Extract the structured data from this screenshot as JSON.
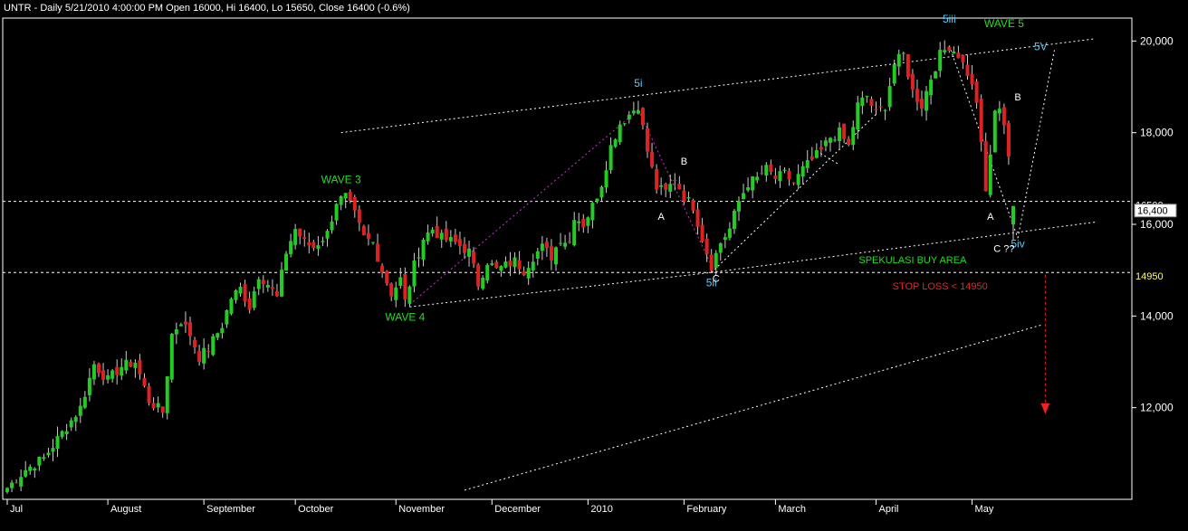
{
  "header": {
    "title": "UNTR - Daily 5/21/2010 4:00:00 PM Open 16000, Hi 16400, Lo 15650, Close 16400 (-0.6%)"
  },
  "colors": {
    "background": "#000000",
    "up": "#22cc22",
    "down": "#dd2222",
    "grid": "#ffffff",
    "wave_label": "#22dd22",
    "sub_label": "#55ccff",
    "stop": "#ee2222",
    "buy": "#22dd22",
    "level": "#ffff66",
    "abc": "#ffffff",
    "wave_line": "#cc33cc"
  },
  "chart_data": {
    "type": "candlestick",
    "title": "UNTR - Daily 5/21/2010 4:00:00 PM Open 16000, Hi 16400, Lo 15650, Close 16400 (-0.6%)",
    "ylim": [
      10000,
      20500
    ],
    "yticks": [
      12000,
      14000,
      16000,
      18000,
      20000
    ],
    "ytick_labels": [
      "12,000",
      "14,000",
      "16,000",
      "18,000",
      "20,000"
    ],
    "x_months": [
      {
        "label": "Jul",
        "index": 0
      },
      {
        "label": "August",
        "index": 22
      },
      {
        "label": "September",
        "index": 43
      },
      {
        "label": "October",
        "index": 63
      },
      {
        "label": "November",
        "index": 85
      },
      {
        "label": "December",
        "index": 106
      },
      {
        "label": "2010",
        "index": 127
      },
      {
        "label": "February",
        "index": 148
      },
      {
        "label": "March",
        "index": 168
      },
      {
        "label": "April",
        "index": 190
      },
      {
        "label": "May",
        "index": 211
      }
    ],
    "n_bars": 221,
    "anchors": [
      [
        0,
        10250
      ],
      [
        4,
        10650
      ],
      [
        8,
        10900
      ],
      [
        12,
        11450
      ],
      [
        16,
        12000
      ],
      [
        19,
        12950
      ],
      [
        22,
        12600
      ],
      [
        25,
        12900
      ],
      [
        28,
        13000
      ],
      [
        31,
        12150
      ],
      [
        34,
        11900
      ],
      [
        36,
        13600
      ],
      [
        38,
        13900
      ],
      [
        40,
        13600
      ],
      [
        42,
        13100
      ],
      [
        44,
        13300
      ],
      [
        47,
        13800
      ],
      [
        49,
        14400
      ],
      [
        51,
        14600
      ],
      [
        53,
        14200
      ],
      [
        55,
        14900
      ],
      [
        57,
        14700
      ],
      [
        59,
        14400
      ],
      [
        61,
        15400
      ],
      [
        63,
        15900
      ],
      [
        65,
        15600
      ],
      [
        67,
        15500
      ],
      [
        70,
        15800
      ],
      [
        72,
        16500
      ],
      [
        74,
        16600
      ],
      [
        76,
        16200
      ],
      [
        78,
        15700
      ],
      [
        80,
        15600
      ],
      [
        82,
        15000
      ],
      [
        84,
        14500
      ],
      [
        86,
        14800
      ],
      [
        87,
        14300
      ],
      [
        89,
        15100
      ],
      [
        91,
        15700
      ],
      [
        93,
        15900
      ],
      [
        95,
        15700
      ],
      [
        98,
        15600
      ],
      [
        101,
        15400
      ],
      [
        103,
        14700
      ],
      [
        105,
        15200
      ],
      [
        107,
        15000
      ],
      [
        109,
        15100
      ],
      [
        111,
        15200
      ],
      [
        113,
        15000
      ],
      [
        115,
        15300
      ],
      [
        117,
        15500
      ],
      [
        119,
        15300
      ],
      [
        121,
        15700
      ],
      [
        123,
        15600
      ],
      [
        124,
        16200
      ],
      [
        126,
        16000
      ],
      [
        128,
        16400
      ],
      [
        130,
        16900
      ],
      [
        132,
        17700
      ],
      [
        134,
        18200
      ],
      [
        136,
        18400
      ],
      [
        138,
        18600
      ],
      [
        140,
        17600
      ],
      [
        142,
        16800
      ],
      [
        144,
        16700
      ],
      [
        146,
        17000
      ],
      [
        148,
        16600
      ],
      [
        150,
        16400
      ],
      [
        152,
        15700
      ],
      [
        154,
        15100
      ],
      [
        156,
        15600
      ],
      [
        158,
        15900
      ],
      [
        160,
        16500
      ],
      [
        162,
        16900
      ],
      [
        164,
        17000
      ],
      [
        166,
        17200
      ],
      [
        168,
        17000
      ],
      [
        170,
        17100
      ],
      [
        172,
        16900
      ],
      [
        174,
        17200
      ],
      [
        176,
        17400
      ],
      [
        178,
        17600
      ],
      [
        180,
        17900
      ],
      [
        182,
        18000
      ],
      [
        184,
        17700
      ],
      [
        186,
        18600
      ],
      [
        188,
        18800
      ],
      [
        190,
        18400
      ],
      [
        192,
        18600
      ],
      [
        194,
        19500
      ],
      [
        196,
        19700
      ],
      [
        198,
        18900
      ],
      [
        200,
        18600
      ],
      [
        202,
        19200
      ],
      [
        204,
        19700
      ],
      [
        206,
        19900
      ],
      [
        208,
        19700
      ],
      [
        210,
        19300
      ],
      [
        212,
        18700
      ],
      [
        214,
        16700
      ],
      [
        216,
        18400
      ],
      [
        217,
        18600
      ],
      [
        218,
        18200
      ],
      [
        219,
        17500
      ],
      [
        220,
        16400
      ]
    ],
    "last_bar": {
      "open": 16000,
      "high": 16400,
      "low": 15650,
      "close": 16400
    },
    "levels": [
      {
        "value": 16500,
        "label": "16500"
      },
      {
        "value": 14950,
        "label": "14950"
      }
    ],
    "last_price": {
      "value": 16400,
      "label": "16,400"
    },
    "annotations": [
      {
        "text": "WAVE 3",
        "type": "wave",
        "index": 73,
        "value": 16900
      },
      {
        "text": "WAVE 4",
        "type": "wave",
        "index": 87,
        "value": 13900
      },
      {
        "text": "WAVE 5",
        "type": "wave",
        "index": 218,
        "value": 20300
      },
      {
        "text": "5i",
        "type": "sub",
        "index": 138,
        "value": 19000
      },
      {
        "text": "5ii",
        "type": "sub",
        "index": 154,
        "value": 14650
      },
      {
        "text": "5iii",
        "type": "sub",
        "index": 206,
        "value": 20400
      },
      {
        "text": "5iv",
        "type": "sub",
        "index": 221,
        "value": 15500
      },
      {
        "text": "5V",
        "type": "sub",
        "index": 226,
        "value": 19800
      },
      {
        "text": "A",
        "type": "abc",
        "index": 143,
        "value": 16100
      },
      {
        "text": "B",
        "type": "abc",
        "index": 148,
        "value": 17300
      },
      {
        "text": "C",
        "type": "abc",
        "index": 155,
        "value": 14750
      },
      {
        "text": "A",
        "type": "abc",
        "index": 215,
        "value": 16100
      },
      {
        "text": "B",
        "type": "abc",
        "index": 221,
        "value": 18700
      },
      {
        "text": "C ??",
        "type": "abc",
        "index": 218,
        "value": 15400
      },
      {
        "text": "SPEKULASI BUY AREA",
        "type": "buy",
        "index": 198,
        "value": 15150
      },
      {
        "text": "STOP LOSS < 14950",
        "type": "stop",
        "index": 204,
        "value": 14580
      }
    ],
    "trendlines": [
      {
        "from": [
          73,
          18000
        ],
        "to": [
          238,
          20050
        ],
        "style": "dotted"
      },
      {
        "from": [
          88,
          14200
        ],
        "to": [
          154,
          14950
        ],
        "style": "dotted"
      },
      {
        "from": [
          154,
          14950
        ],
        "to": [
          238,
          16050
        ],
        "style": "dotted"
      },
      {
        "from": [
          100,
          10200
        ],
        "to": [
          226,
          13800
        ],
        "style": "dotted"
      },
      {
        "from": [
          88,
          14250
        ],
        "to": [
          138,
          18500
        ],
        "style": "dotted-magenta"
      },
      {
        "from": [
          138,
          18500
        ],
        "to": [
          154,
          15100
        ],
        "style": "dotted-magenta"
      },
      {
        "from": [
          154,
          14950
        ],
        "to": [
          190,
          18400
        ],
        "style": "dotted"
      },
      {
        "from": [
          206,
          19900
        ],
        "to": [
          221,
          15700
        ],
        "style": "dotted"
      },
      {
        "from": [
          221,
          15700
        ],
        "to": [
          229,
          19800
        ],
        "style": "dotted"
      },
      {
        "from": [
          177,
          17600
        ],
        "to": [
          182,
          17300
        ],
        "style": "dotted"
      }
    ],
    "stop_arrow": {
      "index": 227,
      "from": 14900,
      "to": 11900
    }
  }
}
